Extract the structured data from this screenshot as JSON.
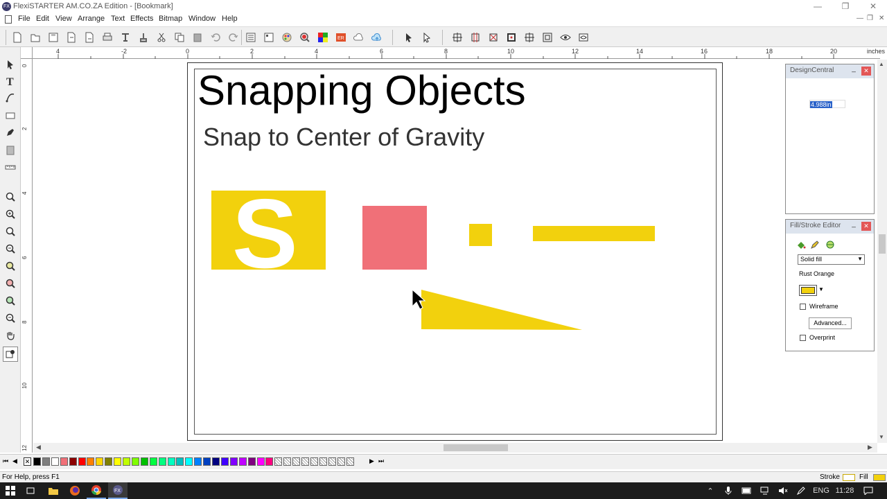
{
  "window": {
    "app_icon_label": "FX",
    "title": "FlexiSTARTER AM.CO.ZA Edition - [Bookmark]",
    "minimize": "—",
    "maximize": "❐",
    "close": "✕"
  },
  "menu": {
    "items": [
      "File",
      "Edit",
      "View",
      "Arrange",
      "Text",
      "Effects",
      "Bitmap",
      "Window",
      "Help"
    ],
    "mdi_min": "—",
    "mdi_restore": "❐",
    "mdi_close": "✕"
  },
  "ruler": {
    "unit": "inches",
    "h_labels": [
      "4",
      "-2",
      "0",
      "2",
      "4",
      "6",
      "8",
      "10",
      "12",
      "14",
      "16",
      "18",
      "20"
    ],
    "v_labels": [
      "0",
      "2",
      "4",
      "6",
      "8",
      "10",
      "12"
    ]
  },
  "document": {
    "heading": "Snapping Objects",
    "subheading": "Snap to Center of Gravity",
    "letter": "S",
    "colors": {
      "yellow": "#f2d10d",
      "pink": "#f07078"
    }
  },
  "design_central": {
    "title": "DesignCentral",
    "value": "4.988in"
  },
  "fill_stroke": {
    "title": "Fill/Stroke Editor",
    "fill_type": "Solid fill",
    "color_name": "Rust Orange",
    "color_hex": "#f2d10d",
    "wireframe_label": "Wireframe",
    "advanced_label": "Advanced...",
    "overprint_label": "Overprint"
  },
  "palette": {
    "colors": [
      "#000000",
      "#7f7f7f",
      "#ffffff",
      "#f07078",
      "#8b0000",
      "#ff0000",
      "#ff8000",
      "#ffd700",
      "#808000",
      "#ffff00",
      "#c0ff00",
      "#80ff00",
      "#00c000",
      "#00ff40",
      "#00ff80",
      "#00ffc0",
      "#00c0c0",
      "#00ffff",
      "#0080ff",
      "#0040c0",
      "#000080",
      "#4000ff",
      "#8000ff",
      "#c000ff",
      "#800080",
      "#ff00ff",
      "#ff0080"
    ]
  },
  "status": {
    "help": "For Help, press F1",
    "stroke_label": "Stroke",
    "fill_label": "Fill"
  },
  "taskbar": {
    "lang": "ENG",
    "time": "11:28"
  }
}
